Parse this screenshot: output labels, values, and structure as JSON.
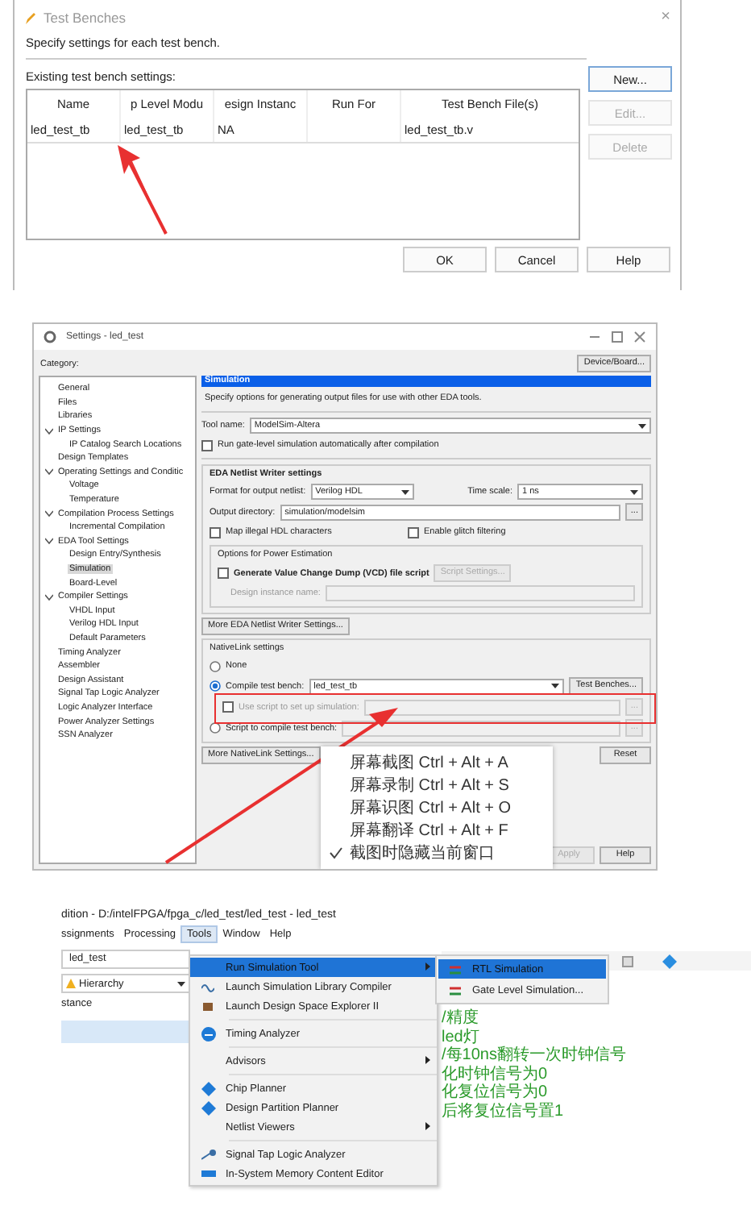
{
  "test_benches_dialog": {
    "title": "Test Benches",
    "close": "×",
    "description": "Specify settings for each test bench.",
    "table_label": "Existing test bench settings:",
    "columns": [
      "Name",
      "p Level Modu",
      "esign Instanc",
      "Run For",
      "Test Bench File(s)"
    ],
    "rows": [
      {
        "name": "led_test_tb",
        "top_level_module": "led_test_tb",
        "design_instance": "NA",
        "test_bench_files": "led_test_tb.v"
      }
    ],
    "side_buttons": [
      {
        "label": "New...",
        "disabled": false
      },
      {
        "label": "Edit...",
        "disabled": true
      },
      {
        "label": "Delete",
        "disabled": true
      }
    ],
    "buttons": [
      "OK",
      "Cancel",
      "Help"
    ]
  },
  "settings_dialog": {
    "title": "Settings - led_test",
    "category_label": "Category:",
    "device_button": "Device/Board...",
    "categories": [
      {
        "label": "General",
        "selected": false
      },
      {
        "label": "Files",
        "selected": false
      },
      {
        "label": "Libraries",
        "selected": false
      },
      {
        "label": "IP Settings",
        "selected": false,
        "expanded": true,
        "children": [
          {
            "label": "IP Catalog Search Locations",
            "selected": false
          }
        ]
      },
      {
        "label": "Design Templates",
        "selected": false
      },
      {
        "label": "Operating Settings and Conditic",
        "selected": false,
        "expanded": true,
        "children": [
          {
            "label": "Voltage",
            "selected": false
          },
          {
            "label": "Temperature",
            "selected": false
          }
        ]
      },
      {
        "label": "Compilation Process Settings",
        "selected": false,
        "expanded": true,
        "children": [
          {
            "label": "Incremental Compilation",
            "selected": false
          }
        ]
      },
      {
        "label": "EDA Tool Settings",
        "selected": false,
        "expanded": true,
        "children": [
          {
            "label": "Design Entry/Synthesis",
            "selected": false
          },
          {
            "label": "Simulation",
            "selected": true
          },
          {
            "label": "Board-Level",
            "selected": false
          }
        ]
      },
      {
        "label": "Compiler Settings",
        "selected": false,
        "expanded": true,
        "children": [
          {
            "label": "VHDL Input",
            "selected": false
          },
          {
            "label": "Verilog HDL Input",
            "selected": false
          },
          {
            "label": "Default Parameters",
            "selected": false
          }
        ]
      },
      {
        "label": "Timing Analyzer",
        "selected": false
      },
      {
        "label": "Assembler",
        "selected": false
      },
      {
        "label": "Design Assistant",
        "selected": false
      },
      {
        "label": "Signal Tap Logic Analyzer",
        "selected": false
      },
      {
        "label": "Logic Analyzer Interface",
        "selected": false
      },
      {
        "label": "Power Analyzer Settings",
        "selected": false
      },
      {
        "label": "SSN Analyzer",
        "selected": false
      }
    ],
    "page_title": "Simulation",
    "description": "Specify options for generating output files for use with other EDA tools.",
    "tool_name": {
      "label": "Tool name:",
      "value": "ModelSim-Altera"
    },
    "run_gate_level": {
      "label": "Run gate-level simulation automatically after compilation",
      "checked": false
    },
    "netlist": {
      "title": "EDA Netlist Writer settings",
      "format_label": "Format for output netlist:",
      "format": "Verilog HDL",
      "time_scale_label": "Time scale:",
      "time_scale": "1 ns",
      "output_dir_label": "Output directory:",
      "output_dir": "simulation/modelsim",
      "browse": "...",
      "map_illegal": {
        "label": "Map illegal HDL characters",
        "checked": false
      },
      "glitch": {
        "label": "Enable glitch filtering",
        "checked": false
      },
      "power": {
        "title": "Options for Power Estimation",
        "vcd": {
          "label": "Generate Value Change Dump (VCD) file script",
          "checked": false
        },
        "script_settings": {
          "label": "Script Settings...",
          "disabled": true
        },
        "instance_label": "Design instance name:",
        "instance_disabled": true
      }
    },
    "more_netlist_button": "More EDA Netlist Writer Settings...",
    "nativelink": {
      "title": "NativeLink settings",
      "none": {
        "label": "None",
        "selected": false
      },
      "compile": {
        "label": "Compile test bench:",
        "selected": true,
        "value": "led_test_tb",
        "button": "Test Benches..."
      },
      "use_script": {
        "label": "Use script to set up simulation:",
        "checked": false,
        "disabled": true,
        "browse": "..."
      },
      "script": {
        "label": "Script to compile test bench:",
        "selected": false,
        "browse": "..."
      }
    },
    "more_nativelink_button": "More NativeLink Settings...",
    "reset_button": "Reset",
    "buttons": [
      "Apply",
      "Help"
    ]
  },
  "screenshot_menu": {
    "items": [
      {
        "label": "屏幕截图 Ctrl + Alt + A",
        "checked": false
      },
      {
        "label": "屏幕录制 Ctrl + Alt + S",
        "checked": false
      },
      {
        "label": "屏幕识图 Ctrl + Alt + O",
        "checked": false
      },
      {
        "label": "屏幕翻译 Ctrl + Alt + F",
        "checked": false
      },
      {
        "label": "截图时隐藏当前窗口",
        "checked": true
      }
    ]
  },
  "quartus_window": {
    "title": "dition - D:/intelFPGA/fpga_c/led_test/led_test - led_test",
    "menu": [
      {
        "label": "ssignments",
        "selected": false
      },
      {
        "label": "Processing",
        "selected": false
      },
      {
        "label": "Tools",
        "selected": true
      },
      {
        "label": "Window",
        "selected": false
      },
      {
        "label": "Help",
        "selected": false
      }
    ],
    "project_field": "led_test",
    "hierarchy_dropdown": "Hierarchy",
    "instance_header": "stance",
    "tools_menu": [
      [
        {
          "label": "Run Simulation Tool",
          "submenu": true,
          "selected": true
        },
        {
          "label": "Launch Simulation Library Compiler",
          "submenu": false,
          "selected": false
        },
        {
          "label": "Launch Design Space Explorer II",
          "submenu": false,
          "selected": false
        }
      ],
      [
        {
          "label": "Timing Analyzer",
          "submenu": false,
          "selected": false
        }
      ],
      [
        {
          "label": "Advisors",
          "submenu": true,
          "selected": false
        }
      ],
      [
        {
          "label": "Chip Planner",
          "submenu": false,
          "selected": false
        },
        {
          "label": "Design Partition Planner",
          "submenu": false,
          "selected": false
        },
        {
          "label": "Netlist Viewers",
          "submenu": true,
          "selected": false
        }
      ],
      [
        {
          "label": "Signal Tap Logic Analyzer",
          "submenu": false,
          "selected": false
        },
        {
          "label": "In-System Memory Content Editor",
          "submenu": false,
          "selected": false
        }
      ]
    ],
    "submenu": [
      {
        "label": "RTL Simulation",
        "selected": true
      },
      {
        "label": "Gate Level Simulation...",
        "selected": false
      }
    ],
    "code_comments": [
      "/精度",
      "led灯",
      "/每10ns翻转一次时钟信号",
      "化时钟信号为0",
      "化复位信号为0",
      "后将复位信号置1"
    ]
  }
}
